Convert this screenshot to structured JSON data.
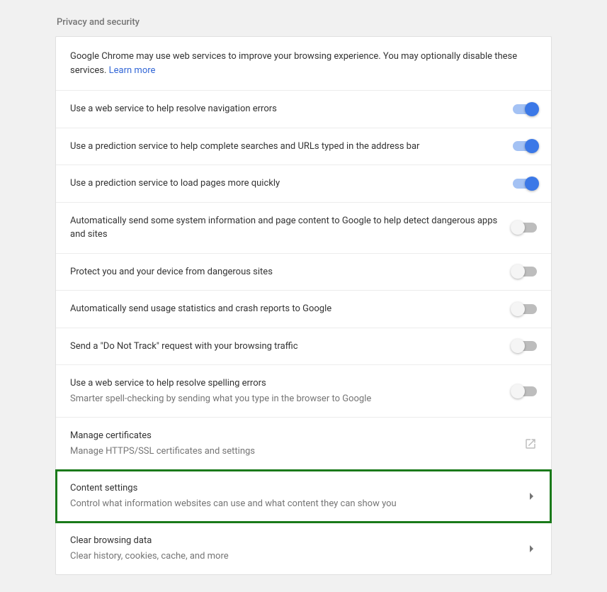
{
  "section": {
    "title": "Privacy and security"
  },
  "intro": {
    "text": "Google Chrome may use web services to improve your browsing experience. You may optionally disable these services. ",
    "link": "Learn more"
  },
  "rows": [
    {
      "label": "Use a web service to help resolve navigation errors",
      "type": "toggle",
      "on": true
    },
    {
      "label": "Use a prediction service to help complete searches and URLs typed in the address bar",
      "type": "toggle",
      "on": true
    },
    {
      "label": "Use a prediction service to load pages more quickly",
      "type": "toggle",
      "on": true
    },
    {
      "label": "Automatically send some system information and page content to Google to help detect dangerous apps and sites",
      "type": "toggle",
      "on": false
    },
    {
      "label": "Protect you and your device from dangerous sites",
      "type": "toggle",
      "on": false
    },
    {
      "label": "Automatically send usage statistics and crash reports to Google",
      "type": "toggle",
      "on": false
    },
    {
      "label": "Send a \"Do Not Track\" request with your browsing traffic",
      "type": "toggle",
      "on": false
    },
    {
      "label": "Use a web service to help resolve spelling errors",
      "sublabel": "Smarter spell-checking by sending what you type in the browser to Google",
      "type": "toggle",
      "on": false
    },
    {
      "label": "Manage certificates",
      "sublabel": "Manage HTTPS/SSL certificates and settings",
      "type": "external"
    },
    {
      "label": "Content settings",
      "sublabel": "Control what information websites can use and what content they can show you",
      "type": "arrow",
      "highlighted": true
    },
    {
      "label": "Clear browsing data",
      "sublabel": "Clear history, cookies, cache, and more",
      "type": "arrow"
    }
  ]
}
